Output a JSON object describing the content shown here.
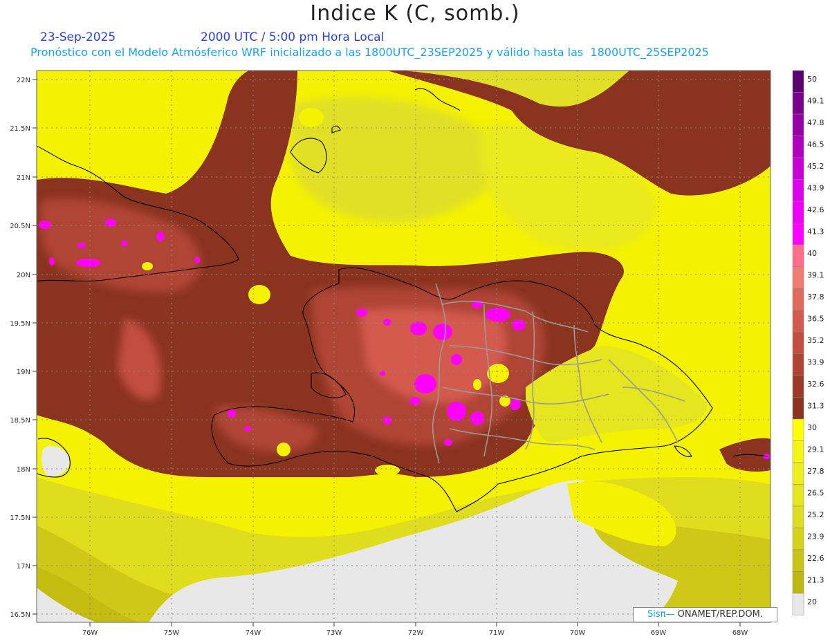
{
  "header": {
    "title": "Indice K (C, somb.)",
    "date": "23-Sep-2025",
    "time": "2000 UTC / 5:00 pm Hora Local",
    "description": "Pronóstico con el Modelo Atmósferico WRF inicializado a las 1800UTC_23SEP2025 y válido hasta las  1800UTC_25SEP2025"
  },
  "map": {
    "lat_labels": [
      "22N",
      "21.5N",
      "21N",
      "20.5N",
      "20N",
      "19.5N",
      "19N",
      "18.5N",
      "18N",
      "17.5N",
      "17N",
      "16.5N"
    ],
    "lon_labels": [
      "76W",
      "75W",
      "74W",
      "73W",
      "72W",
      "71W",
      "70W",
      "69W",
      "68W"
    ],
    "lat_range": [
      16.4,
      22.1
    ],
    "lon_range": [
      -76.7,
      -67.6
    ]
  },
  "colorbar": {
    "labels": [
      "50",
      "49.1",
      "47.8",
      "46.5",
      "45.2",
      "43.9",
      "42.6",
      "41.3",
      "40",
      "39.1",
      "37.8",
      "36.5",
      "35.2",
      "33.9",
      "32.6",
      "31.3",
      "30",
      "29.1",
      "27.8",
      "26.5",
      "25.2",
      "23.9",
      "22.6",
      "21.3",
      "20"
    ],
    "colors": [
      "#5a0070",
      "#7a008c",
      "#9600a8",
      "#b000c0",
      "#c800d8",
      "#dd00ea",
      "#ee00f8",
      "#ff00ff",
      "#ff6c8c",
      "#f07c72",
      "#e06a5e",
      "#d35a4e",
      "#c24e40",
      "#b04434",
      "#9c3a28",
      "#8a331f",
      "#ffff00",
      "#f6f416",
      "#eeee1c",
      "#e6e620",
      "#dede1e",
      "#d4d21a",
      "#cac416",
      "#beb810",
      "#e8e8e8"
    ]
  },
  "credit": {
    "brand": "Sisπ—",
    "text": " ONAMET/REP.DOM."
  }
}
